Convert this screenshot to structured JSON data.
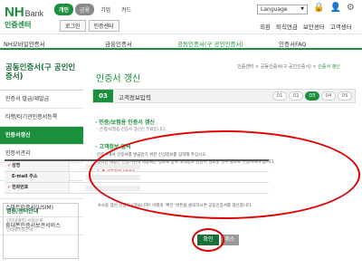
{
  "header": {
    "logo_main": "NH",
    "logo_sub": "Bank",
    "group_tabs": [
      "개인",
      "금융",
      "기업",
      "카드"
    ],
    "section_title": "인증센터",
    "buttons": [
      "로그인",
      "인증센터"
    ],
    "language": "Language",
    "links": [
      "외환",
      "퇴직연금",
      "보안센터",
      "고객센터"
    ]
  },
  "gnb": {
    "items": [
      "NH모바일인증서",
      "금융인증서",
      "공동인증서(구 공인인증서)",
      "인증서FAQ"
    ]
  },
  "sidebar": {
    "title": "공동인증서(구 공인인증서)",
    "items": [
      "인증서 발급/재발급",
      "타행/타기관인증서등록",
      "인증서갱신",
      "인증서관리",
      "인증서 수요",
      "공동인증서혁사",
      "스마트인증서(USIM)",
      "휴대폰인증서보관서비스"
    ],
    "box_title": "병원/센터안내",
    "box_lines": [
      "인터넷뱅킹/ 이용등록",
      "인터넷이용안내"
    ]
  },
  "main": {
    "breadcrumb": [
      "인증센터",
      "공동인증서(구 공인인증서)"
    ],
    "breadcrumb_last": "인증서 갱신",
    "page_title": "인증서 갱신",
    "step": {
      "current_num": "03",
      "current_name": "고객정보입력",
      "numbers": [
        "01",
        "02",
        "03",
        "04",
        "05"
      ],
      "active_index": 2
    },
    "section1": {
      "heading": "· 인증/보험용 인증서 갱신",
      "sub": "- 은행/보험용 인증서 갱신은 무료입니다."
    },
    "section2": {
      "heading": "· 고객정보 입력",
      "lines": [
        "인증서에서 인증서를 발급받기 위한 신상정보를 입력해 주십시오.",
        "입력한 내용은 인증기관에 제공되는 정보로 등록 고객정보 변경이 필요할 경우 별도로 신청하셔야 합니다."
      ],
      "required_note": "✓ 표 필수항목 입니다."
    },
    "form_rows": [
      {
        "label": "성명",
        "required": "✓"
      },
      {
        "label": "E-mail 주소",
        "required": ""
      },
      {
        "label": "전화번호",
        "required": "✓"
      }
    ],
    "form_note": "※사용 갱신 신청하시겠습니까? 아래의 '확인' 버튼을 클릭하시면 공동인증서를 갱신합니다.",
    "confirm_label": "확인",
    "cancel_label": "취소"
  },
  "colors": {
    "brand": "#1a8f3c",
    "annotation": "#e00000"
  }
}
